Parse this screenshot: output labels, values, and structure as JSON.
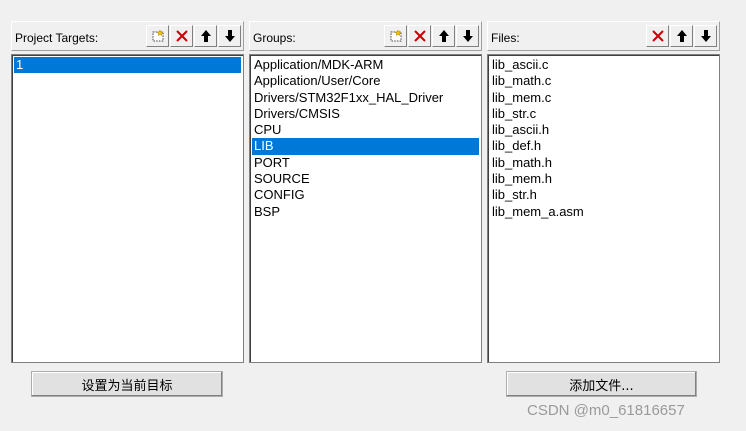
{
  "targets": {
    "title": "Project Targets:",
    "items": [
      {
        "label": "1",
        "selected": true
      }
    ],
    "set_current_label": "设置为当前目标"
  },
  "groups": {
    "title": "Groups:",
    "items": [
      {
        "label": "Application/MDK-ARM",
        "selected": false
      },
      {
        "label": "Application/User/Core",
        "selected": false
      },
      {
        "label": "Drivers/STM32F1xx_HAL_Driver",
        "selected": false
      },
      {
        "label": "Drivers/CMSIS",
        "selected": false
      },
      {
        "label": "CPU",
        "selected": false
      },
      {
        "label": "LIB",
        "selected": true
      },
      {
        "label": "PORT",
        "selected": false
      },
      {
        "label": "SOURCE",
        "selected": false
      },
      {
        "label": "CONFIG",
        "selected": false
      },
      {
        "label": "BSP",
        "selected": false
      }
    ]
  },
  "files": {
    "title": "Files:",
    "items": [
      {
        "label": "lib_ascii.c"
      },
      {
        "label": "lib_math.c"
      },
      {
        "label": "lib_mem.c"
      },
      {
        "label": "lib_str.c"
      },
      {
        "label": "lib_ascii.h"
      },
      {
        "label": "lib_def.h"
      },
      {
        "label": "lib_math.h"
      },
      {
        "label": "lib_mem.h"
      },
      {
        "label": "lib_str.h"
      },
      {
        "label": "lib_mem_a.asm"
      }
    ],
    "add_files_label": "添加文件..."
  },
  "watermark": "CSDN @m0_61816657",
  "colors": {
    "selection": "#0078d7",
    "delete_icon": "#cc0000"
  },
  "icons": [
    "new-item-icon",
    "delete-icon",
    "move-up-icon",
    "move-down-icon"
  ]
}
